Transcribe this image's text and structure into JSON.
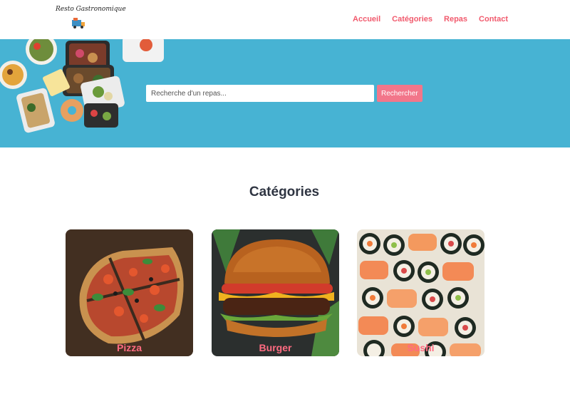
{
  "header": {
    "logo_text": "Resto Gastronomique",
    "nav": [
      "Accueil",
      "Catégories",
      "Repas",
      "Contact"
    ]
  },
  "hero": {
    "search_placeholder": "Recherche d'un repas...",
    "search_button": "Rechercher"
  },
  "categories": {
    "title": "Catégories",
    "items": [
      "Pizza",
      "Burger",
      "Sushi"
    ]
  },
  "colors": {
    "accent": "#f15a6d",
    "hero_bg": "#47b3d3",
    "button_bg": "#f2768a",
    "title": "#2f3542"
  }
}
